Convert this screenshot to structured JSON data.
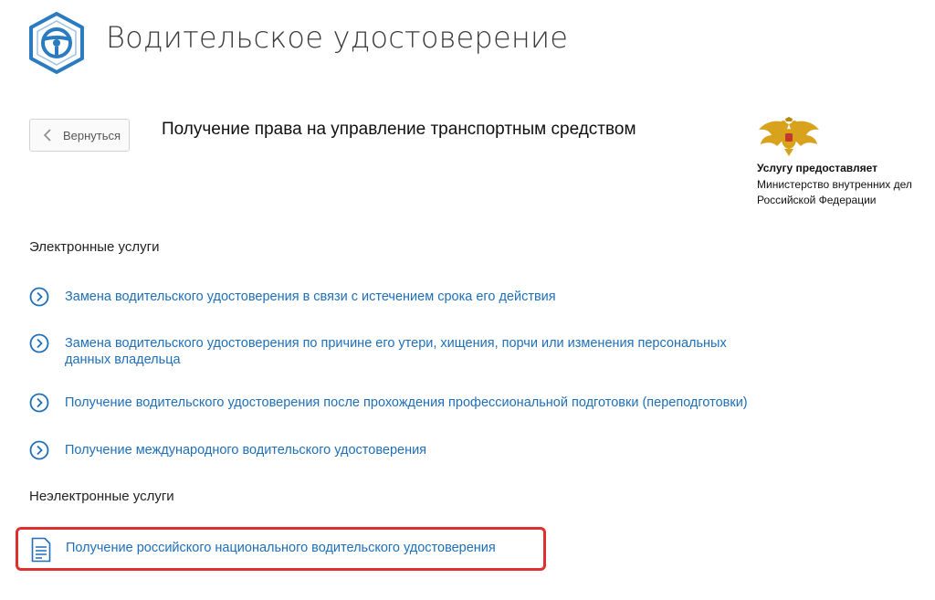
{
  "header": {
    "title": "Водительское удостоверение",
    "logo_icon": "steering-wheel-icon"
  },
  "back_button": {
    "label": "Вернуться"
  },
  "service": {
    "title": "Получение права на управление транспортным средством"
  },
  "provider": {
    "label": "Услугу предоставляет",
    "name": "Министерство внутренних дел Российской Федерации",
    "emblem_icon": "coat-of-arms-icon"
  },
  "electronic": {
    "heading": "Электронные услуги",
    "items": [
      {
        "label": "Замена водительского удостоверения в связи с истечением срока его действия"
      },
      {
        "label": "Замена водительского удостоверения по причине его утери, хищения, порчи или изменения персональных данных владельца"
      },
      {
        "label": "Получение водительского удостоверения после прохождения профессиональной подготовки (переподготовки)"
      },
      {
        "label": "Получение международного водительского удостоверения"
      }
    ]
  },
  "non_electronic": {
    "heading": "Неэлектронные услуги",
    "items": [
      {
        "label": "Получение российского национального водительского удостоверения"
      }
    ]
  },
  "colors": {
    "link": "#1f6fb8",
    "accent": "#2a7bbf",
    "highlight": "#e0302e",
    "emblem_gold": "#d9a21c"
  }
}
